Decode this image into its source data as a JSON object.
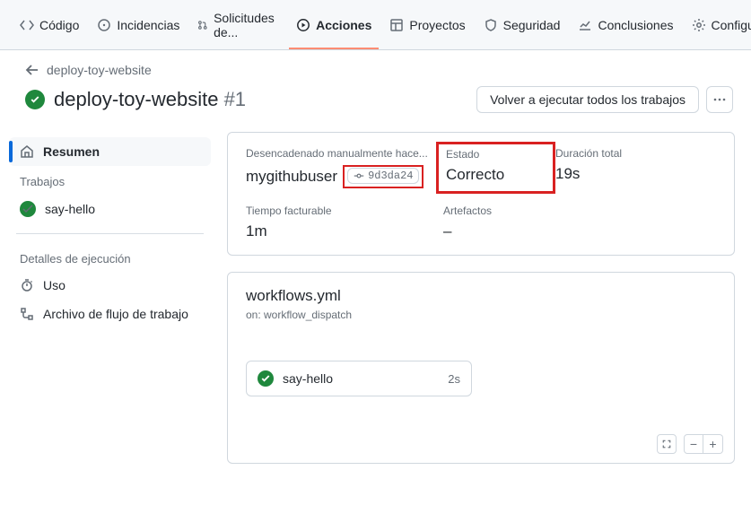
{
  "nav": {
    "code": "Código",
    "issues": "Incidencias",
    "pulls": "Solicitudes de...",
    "actions": "Acciones",
    "projects": "Proyectos",
    "security": "Seguridad",
    "insights": "Conclusiones",
    "settings": "Configuración"
  },
  "breadcrumb": {
    "workflow": "deploy-toy-website"
  },
  "run": {
    "title": "deploy-toy-website",
    "number": "#1"
  },
  "buttons": {
    "rerun": "Volver a ejecutar todos los trabajos"
  },
  "sidebar": {
    "summary": "Resumen",
    "jobs_section": "Trabajos",
    "job0": "say-hello",
    "details_section": "Detalles de ejecución",
    "usage": "Uso",
    "workflow_file": "Archivo de flujo de trabajo"
  },
  "meta": {
    "triggered_label": "Desencadenado manualmente hace...",
    "user": "mygithubuser",
    "commit": "9d3da24",
    "status_label": "Estado",
    "status_value": "Correcto",
    "duration_label": "Duración total",
    "duration_value": "19s",
    "billable_label": "Tiempo facturable",
    "billable_value": "1m",
    "artifacts_label": "Artefactos",
    "artifacts_value": "–"
  },
  "workflow_card": {
    "file": "workflows.yml",
    "trigger": "on: workflow_dispatch",
    "job_name": "say-hello",
    "job_time": "2s"
  }
}
